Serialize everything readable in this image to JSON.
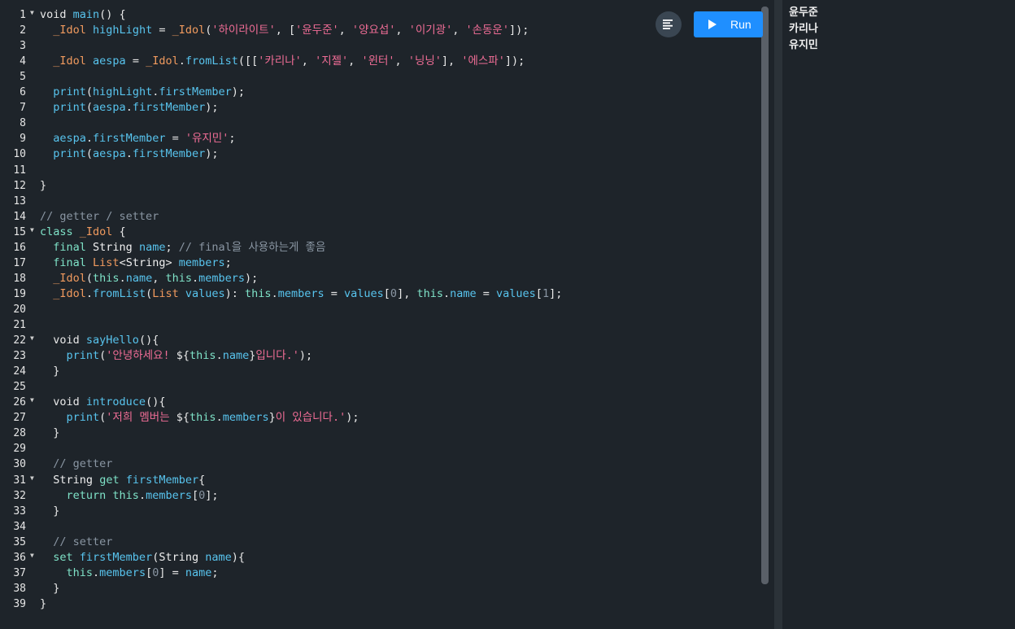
{
  "toolbar": {
    "run_label": "Run"
  },
  "output": {
    "lines": [
      "윤두준",
      "카리나",
      "유지민"
    ]
  },
  "editor": {
    "fold_lines": [
      1,
      15,
      22,
      26,
      31,
      36
    ],
    "lines": [
      [
        [
          "kw",
          "void "
        ],
        [
          "fn",
          "main"
        ],
        [
          "punc",
          "() {"
        ]
      ],
      [
        [
          "punc",
          "  "
        ],
        [
          "cls",
          "_Idol"
        ],
        [
          "punc",
          " "
        ],
        [
          "fn",
          "highLight"
        ],
        [
          "punc",
          " = "
        ],
        [
          "cls",
          "_Idol"
        ],
        [
          "punc",
          "("
        ],
        [
          "str",
          "'하이라이트'"
        ],
        [
          "punc",
          ", ["
        ],
        [
          "str",
          "'윤두준'"
        ],
        [
          "punc",
          ", "
        ],
        [
          "str",
          "'양요섭'"
        ],
        [
          "punc",
          ", "
        ],
        [
          "str",
          "'이기광'"
        ],
        [
          "punc",
          ", "
        ],
        [
          "str",
          "'손동운'"
        ],
        [
          "punc",
          "]);"
        ]
      ],
      [],
      [
        [
          "punc",
          "  "
        ],
        [
          "cls",
          "_Idol"
        ],
        [
          "punc",
          " "
        ],
        [
          "fn",
          "aespa"
        ],
        [
          "punc",
          " = "
        ],
        [
          "cls",
          "_Idol"
        ],
        [
          "punc",
          "."
        ],
        [
          "fn",
          "fromList"
        ],
        [
          "punc",
          "([["
        ],
        [
          "str",
          "'카리나'"
        ],
        [
          "punc",
          ", "
        ],
        [
          "str",
          "'지젤'"
        ],
        [
          "punc",
          ", "
        ],
        [
          "str",
          "'윈터'"
        ],
        [
          "punc",
          ", "
        ],
        [
          "str",
          "'닝닝'"
        ],
        [
          "punc",
          "], "
        ],
        [
          "str",
          "'에스파'"
        ],
        [
          "punc",
          "]);"
        ]
      ],
      [],
      [
        [
          "punc",
          "  "
        ],
        [
          "fn",
          "print"
        ],
        [
          "punc",
          "("
        ],
        [
          "fn",
          "highLight"
        ],
        [
          "punc",
          "."
        ],
        [
          "prop",
          "firstMember"
        ],
        [
          "punc",
          ");"
        ]
      ],
      [
        [
          "punc",
          "  "
        ],
        [
          "fn",
          "print"
        ],
        [
          "punc",
          "("
        ],
        [
          "fn",
          "aespa"
        ],
        [
          "punc",
          "."
        ],
        [
          "prop",
          "firstMember"
        ],
        [
          "punc",
          ");"
        ]
      ],
      [],
      [
        [
          "punc",
          "  "
        ],
        [
          "fn",
          "aespa"
        ],
        [
          "punc",
          "."
        ],
        [
          "prop",
          "firstMember"
        ],
        [
          "punc",
          " = "
        ],
        [
          "str",
          "'유지민'"
        ],
        [
          "punc",
          ";"
        ]
      ],
      [
        [
          "punc",
          "  "
        ],
        [
          "fn",
          "print"
        ],
        [
          "punc",
          "("
        ],
        [
          "fn",
          "aespa"
        ],
        [
          "punc",
          "."
        ],
        [
          "prop",
          "firstMember"
        ],
        [
          "punc",
          ");"
        ]
      ],
      [],
      [
        [
          "punc",
          "}"
        ]
      ],
      [],
      [
        [
          "cmt",
          "// getter / setter"
        ]
      ],
      [
        [
          "kw2",
          "class "
        ],
        [
          "cls",
          "_Idol"
        ],
        [
          "punc",
          " {"
        ]
      ],
      [
        [
          "punc",
          "  "
        ],
        [
          "kw2",
          "final "
        ],
        [
          "typ",
          "String"
        ],
        [
          "punc",
          " "
        ],
        [
          "prop",
          "name"
        ],
        [
          "punc",
          "; "
        ],
        [
          "cmt",
          "// final을 사용하는게 좋음"
        ]
      ],
      [
        [
          "punc",
          "  "
        ],
        [
          "kw2",
          "final "
        ],
        [
          "cls",
          "List"
        ],
        [
          "punc",
          "<"
        ],
        [
          "typ",
          "String"
        ],
        [
          "punc",
          "> "
        ],
        [
          "prop",
          "members"
        ],
        [
          "punc",
          ";"
        ]
      ],
      [
        [
          "punc",
          "  "
        ],
        [
          "cls",
          "_Idol"
        ],
        [
          "punc",
          "("
        ],
        [
          "this",
          "this"
        ],
        [
          "punc",
          "."
        ],
        [
          "prop",
          "name"
        ],
        [
          "punc",
          ", "
        ],
        [
          "this",
          "this"
        ],
        [
          "punc",
          "."
        ],
        [
          "prop",
          "members"
        ],
        [
          "punc",
          ");"
        ]
      ],
      [
        [
          "punc",
          "  "
        ],
        [
          "cls",
          "_Idol"
        ],
        [
          "punc",
          "."
        ],
        [
          "fn",
          "fromList"
        ],
        [
          "punc",
          "("
        ],
        [
          "cls",
          "List"
        ],
        [
          "punc",
          " "
        ],
        [
          "fn",
          "values"
        ],
        [
          "punc",
          "): "
        ],
        [
          "this",
          "this"
        ],
        [
          "punc",
          "."
        ],
        [
          "prop",
          "members"
        ],
        [
          "punc",
          " = "
        ],
        [
          "fn",
          "values"
        ],
        [
          "punc",
          "["
        ],
        [
          "num",
          "0"
        ],
        [
          "punc",
          "], "
        ],
        [
          "this",
          "this"
        ],
        [
          "punc",
          "."
        ],
        [
          "prop",
          "name"
        ],
        [
          "punc",
          " = "
        ],
        [
          "fn",
          "values"
        ],
        [
          "punc",
          "["
        ],
        [
          "num",
          "1"
        ],
        [
          "punc",
          "];"
        ]
      ],
      [],
      [],
      [
        [
          "punc",
          "  "
        ],
        [
          "kw",
          "void "
        ],
        [
          "fn",
          "sayHello"
        ],
        [
          "punc",
          "(){"
        ]
      ],
      [
        [
          "punc",
          "    "
        ],
        [
          "fn",
          "print"
        ],
        [
          "punc",
          "("
        ],
        [
          "str",
          "'안녕하세요! "
        ],
        [
          "punc",
          "${"
        ],
        [
          "this",
          "this"
        ],
        [
          "punc",
          "."
        ],
        [
          "prop",
          "name"
        ],
        [
          "punc",
          "}"
        ],
        [
          "str",
          "입니다.'"
        ],
        [
          "punc",
          ");"
        ]
      ],
      [
        [
          "punc",
          "  }"
        ]
      ],
      [],
      [
        [
          "punc",
          "  "
        ],
        [
          "kw",
          "void "
        ],
        [
          "fn",
          "introduce"
        ],
        [
          "punc",
          "(){"
        ]
      ],
      [
        [
          "punc",
          "    "
        ],
        [
          "fn",
          "print"
        ],
        [
          "punc",
          "("
        ],
        [
          "str",
          "'저희 멤버는 "
        ],
        [
          "punc",
          "${"
        ],
        [
          "this",
          "this"
        ],
        [
          "punc",
          "."
        ],
        [
          "prop",
          "members"
        ],
        [
          "punc",
          "}"
        ],
        [
          "str",
          "이 있습니다.'"
        ],
        [
          "punc",
          ");"
        ]
      ],
      [
        [
          "punc",
          "  }"
        ]
      ],
      [],
      [
        [
          "punc",
          "  "
        ],
        [
          "cmt",
          "// getter"
        ]
      ],
      [
        [
          "punc",
          "  "
        ],
        [
          "typ",
          "String"
        ],
        [
          "punc",
          " "
        ],
        [
          "kw2",
          "get "
        ],
        [
          "fn",
          "firstMember"
        ],
        [
          "punc",
          "{"
        ]
      ],
      [
        [
          "punc",
          "    "
        ],
        [
          "kw2",
          "return "
        ],
        [
          "this",
          "this"
        ],
        [
          "punc",
          "."
        ],
        [
          "prop",
          "members"
        ],
        [
          "punc",
          "["
        ],
        [
          "num",
          "0"
        ],
        [
          "punc",
          "];"
        ]
      ],
      [
        [
          "punc",
          "  }"
        ]
      ],
      [],
      [
        [
          "punc",
          "  "
        ],
        [
          "cmt",
          "// setter"
        ]
      ],
      [
        [
          "punc",
          "  "
        ],
        [
          "kw2",
          "set "
        ],
        [
          "fn",
          "firstMember"
        ],
        [
          "punc",
          "("
        ],
        [
          "typ",
          "String"
        ],
        [
          "punc",
          " "
        ],
        [
          "prop",
          "name"
        ],
        [
          "punc",
          "){"
        ]
      ],
      [
        [
          "punc",
          "    "
        ],
        [
          "this",
          "this"
        ],
        [
          "punc",
          "."
        ],
        [
          "prop",
          "members"
        ],
        [
          "punc",
          "["
        ],
        [
          "num",
          "0"
        ],
        [
          "punc",
          "] = "
        ],
        [
          "prop",
          "name"
        ],
        [
          "punc",
          ";"
        ]
      ],
      [
        [
          "punc",
          "  }"
        ]
      ],
      [
        [
          "punc",
          "}"
        ]
      ]
    ]
  }
}
